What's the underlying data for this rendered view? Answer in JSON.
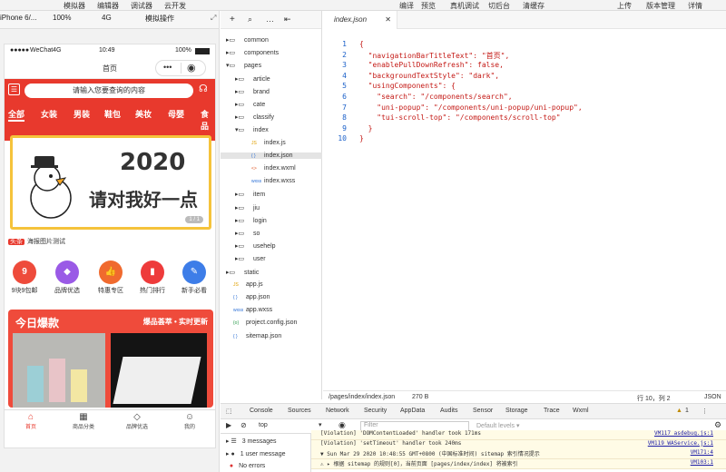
{
  "topbar": {
    "left": [
      "模拟器",
      "编辑器",
      "调试器",
      "云开发"
    ],
    "right": [
      "编译",
      "预览",
      "真机调试",
      "切后台",
      "清缓存",
      "上传",
      "版本管理",
      "详情"
    ]
  },
  "sim_toolbar": {
    "device": "iPhone 6/...",
    "zoom": "100%",
    "network": "4G",
    "action": "模拟操作"
  },
  "phone": {
    "carrier": "WeChat4G",
    "time": "10:49",
    "battery": "100%",
    "nav_title": "首页",
    "search_placeholder": "请输入您要查询的内容",
    "categories": [
      "全部",
      "女装",
      "男装",
      "鞋包",
      "美妆",
      "母婴",
      "食品"
    ],
    "banner_title": "2020",
    "banner_sub": "请对我好一点",
    "banner_pager": "1 / 1",
    "news_tag": "头条",
    "news_text": "海报图片测试",
    "quick_icons": [
      {
        "label": "9块9包邮",
        "glyph": "9",
        "color": "#ee4b3b"
      },
      {
        "label": "品牌优选",
        "glyph": "◆",
        "color": "#9a5ae6"
      },
      {
        "label": "特惠专区",
        "glyph": "👍",
        "color": "#f06a2e"
      },
      {
        "label": "热门排行",
        "glyph": "▮",
        "color": "#ee3b3b"
      },
      {
        "label": "新手必看",
        "glyph": "✎",
        "color": "#3d7de8"
      }
    ],
    "hot_title": "今日爆款",
    "hot_right": "爆品荟萃 • 实时更新",
    "tabs": [
      {
        "label": "首页",
        "glyph": "⌂"
      },
      {
        "label": "商品分类",
        "glyph": "▦"
      },
      {
        "label": "品牌优选",
        "glyph": "◇"
      },
      {
        "label": "我的",
        "glyph": "☺"
      }
    ]
  },
  "tree": [
    {
      "label": "common",
      "type": "folder",
      "depth": 0,
      "open": false
    },
    {
      "label": "components",
      "type": "folder",
      "depth": 0,
      "open": false
    },
    {
      "label": "pages",
      "type": "folder",
      "depth": 0,
      "open": true
    },
    {
      "label": "article",
      "type": "folder",
      "depth": 1,
      "open": false
    },
    {
      "label": "brand",
      "type": "folder",
      "depth": 1,
      "open": false
    },
    {
      "label": "cate",
      "type": "folder",
      "depth": 1,
      "open": false
    },
    {
      "label": "classify",
      "type": "folder",
      "depth": 1,
      "open": false
    },
    {
      "label": "index",
      "type": "folder",
      "depth": 1,
      "open": true
    },
    {
      "label": "index.js",
      "type": "js",
      "depth": 2
    },
    {
      "label": "index.json",
      "type": "json",
      "depth": 2,
      "selected": true
    },
    {
      "label": "index.wxml",
      "type": "wxml",
      "depth": 2
    },
    {
      "label": "index.wxss",
      "type": "wxss",
      "depth": 2
    },
    {
      "label": "item",
      "type": "folder",
      "depth": 1,
      "open": false
    },
    {
      "label": "jiu",
      "type": "folder",
      "depth": 1,
      "open": false
    },
    {
      "label": "login",
      "type": "folder",
      "depth": 1,
      "open": false
    },
    {
      "label": "so",
      "type": "folder",
      "depth": 1,
      "open": false
    },
    {
      "label": "usehelp",
      "type": "folder",
      "depth": 1,
      "open": false
    },
    {
      "label": "user",
      "type": "folder",
      "depth": 1,
      "open": false
    },
    {
      "label": "static",
      "type": "folder",
      "depth": 0,
      "open": false
    },
    {
      "label": "app.js",
      "type": "js",
      "depth": 0
    },
    {
      "label": "app.json",
      "type": "json",
      "depth": 0
    },
    {
      "label": "app.wxss",
      "type": "wxss",
      "depth": 0
    },
    {
      "label": "project.config.json",
      "type": "config",
      "depth": 0
    },
    {
      "label": "sitemap.json",
      "type": "json",
      "depth": 0
    }
  ],
  "editor": {
    "tab_label": "index.json",
    "lines": [
      "{",
      "  \"navigationBarTitleText\": \"首页\",",
      "  \"enablePullDownRefresh\": false,",
      "  \"backgroundTextStyle\": \"dark\",",
      "  \"usingComponents\": {",
      "    \"search\": \"/components/search\",",
      "    \"uni-popup\": \"/components/uni-popup/uni-popup\",",
      "    \"tui-scroll-top\": \"/components/scroll-top\"",
      "  }",
      "}"
    ],
    "status_path": "/pages/index/index.json",
    "status_size": "270 B",
    "status_cursor": "行 10，列 2",
    "status_lang": "JSON"
  },
  "devtools": {
    "tabs": [
      "Console",
      "Sources",
      "Network",
      "Security",
      "AppData",
      "Audits",
      "Sensor",
      "Storage",
      "Trace",
      "Wxml"
    ],
    "warn_count": "1",
    "context": "top",
    "filter_placeholder": "Filter",
    "levels": "Default levels ▾",
    "side": [
      "3 messages",
      "1 user message",
      "No errors"
    ],
    "logs": [
      {
        "text": "[Violation] 'DOMContentLoaded' handler took 171ms",
        "src": "VM117 asdebug.js:1"
      },
      {
        "text": "[Violation] 'setTimeout' handler took 240ms",
        "src": "VM119 WAService.js:1"
      },
      {
        "text": "▼ Sun Mar 29 2020 10:48:55 GMT+0800 (中国标准时间) sitemap 索引情况提示",
        "src": "VM171:4"
      },
      {
        "text": "⚠ ▸ 根据 sitemap 的规则[0]，当前页面 [pages/index/index] 将被索引",
        "src": "VM103:1"
      }
    ]
  }
}
